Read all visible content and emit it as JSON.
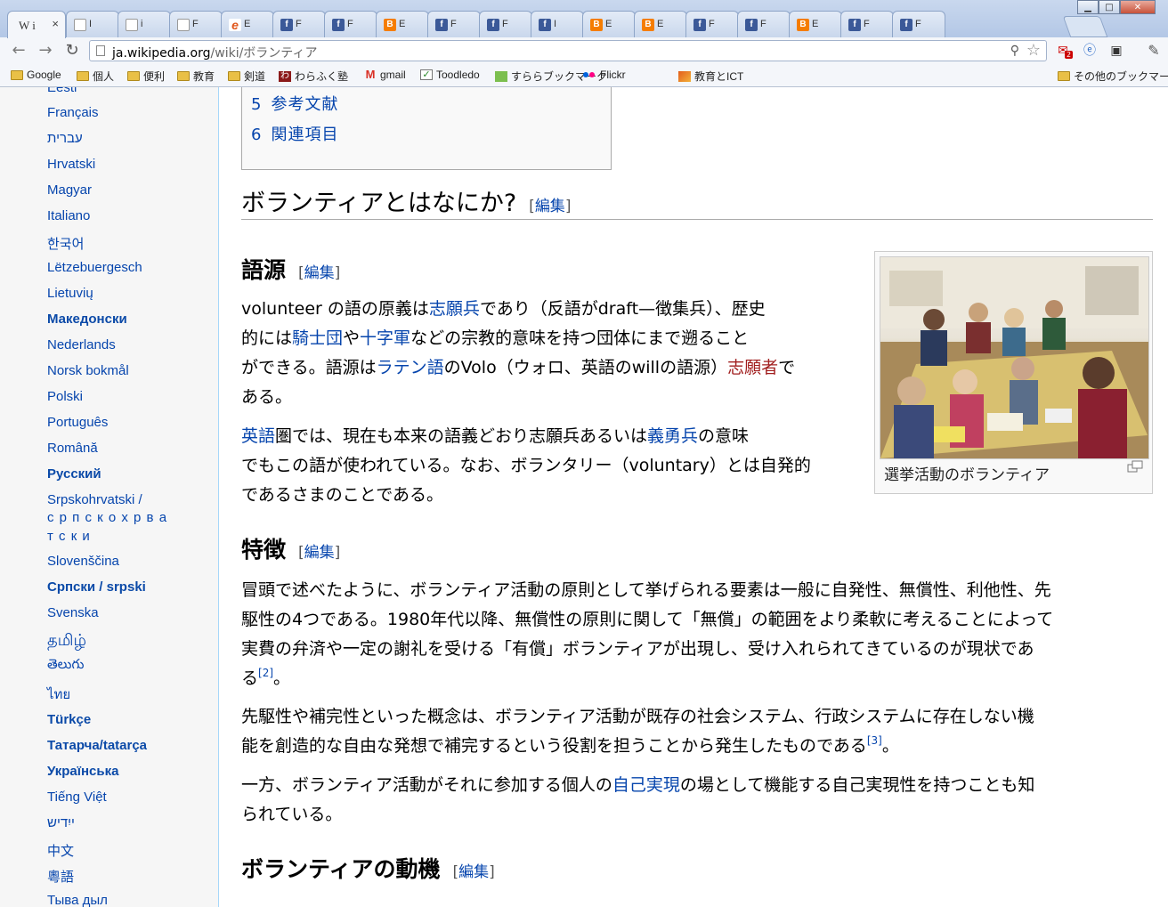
{
  "browser": {
    "tabs": [
      {
        "title": "W i",
        "icon": "wikipedia-w-icon",
        "active": true
      },
      {
        "title": "I",
        "icon": "page-icon"
      },
      {
        "title": "i",
        "icon": "page-icon"
      },
      {
        "title": "F",
        "icon": "page-icon"
      },
      {
        "title": "E",
        "icon": "ie-icon"
      },
      {
        "title": "F",
        "icon": "facebook-icon"
      },
      {
        "title": "F",
        "icon": "facebook-icon"
      },
      {
        "title": "E",
        "icon": "blogger-icon"
      },
      {
        "title": "F",
        "icon": "facebook-icon"
      },
      {
        "title": "F",
        "icon": "facebook-icon"
      },
      {
        "title": "I",
        "icon": "facebook-icon"
      },
      {
        "title": "E",
        "icon": "blogger-icon"
      },
      {
        "title": "E",
        "icon": "blogger-icon"
      },
      {
        "title": "F",
        "icon": "facebook-icon"
      },
      {
        "title": "F",
        "icon": "facebook-icon"
      },
      {
        "title": "E",
        "icon": "blogger-icon"
      },
      {
        "title": "F",
        "icon": "facebook-icon"
      },
      {
        "title": "F",
        "icon": "facebook-icon"
      }
    ],
    "tab_close": "×",
    "window_buttons": {
      "minimize": "▁",
      "maximize": "□",
      "close": "✕"
    },
    "url_host": "ja.wikipedia.org",
    "url_path": "/wiki/ボランティア",
    "zoom_glyph": "⚲",
    "star_glyph": "☆",
    "ext_badge": "2",
    "bookmarks": [
      {
        "label": "Google",
        "icon": "folder"
      },
      {
        "label": "個人",
        "icon": "folder"
      },
      {
        "label": "便利",
        "icon": "folder"
      },
      {
        "label": "教育",
        "icon": "folder"
      },
      {
        "label": "剣道",
        "icon": "folder"
      },
      {
        "label": "わらふく塾",
        "icon": "waraku"
      },
      {
        "label": "gmail",
        "icon": "gmail"
      },
      {
        "label": "Toodledo",
        "icon": "check"
      },
      {
        "label": "すららブックマーク",
        "icon": "srr"
      },
      {
        "label": "Flickr",
        "icon": "flickr"
      },
      {
        "label": "教育とICT",
        "icon": "ict"
      }
    ],
    "other_bookmarks": "その他のブックマーク"
  },
  "sidebar": {
    "languages": [
      "Eesti",
      "Français",
      "עברית",
      "Hrvatski",
      "Magyar",
      "Italiano",
      "한국어",
      "Lëtzebuergesch",
      "Lietuvių",
      "Македонски",
      "Nederlands",
      "Norsk bokmål",
      "Polski",
      "Português",
      "Română",
      "Русский",
      "Srpskohrvatski /",
      "с р п с к о х р в а",
      "т с к и",
      "Slovenščina",
      "Српски / srpski",
      "Svenska",
      "தமிழ்",
      "తెలుగు",
      "ไทย",
      "Türkçe",
      "Татарча/tatarça",
      "Українська",
      "Tiếng Việt",
      "ייִדיש",
      "中文",
      "粵語",
      "Тыва дыл"
    ]
  },
  "toc": [
    {
      "num": "5",
      "label": "参考文献"
    },
    {
      "num": "6",
      "label": "関連項目"
    }
  ],
  "edit_label": "編集",
  "sections": {
    "what": {
      "heading": "ボランティアとはなにか?"
    },
    "etymology": {
      "heading": "語源",
      "p1": {
        "t1": "volunteer の語の原義は",
        "l1": "志願兵",
        "t2": "であり（反語がdraft—徴集兵）、歴史",
        "t3": "的には",
        "l2": "騎士団",
        "t4": "や",
        "l3": "十字軍",
        "t5": "などの宗教的意味を持つ団体にまで遡ること",
        "t6": "ができる。語源は",
        "l4": "ラテン語",
        "t7": "のVolo（ウォロ、英語のwillの語源）",
        "l5": "志願者",
        "t8": "で",
        "t9": "ある。"
      },
      "p2": {
        "l1": "英語",
        "t1": "圏では、現在も本来の語義どおり志願兵あるいは",
        "l2": "義勇兵",
        "t2": "の意味",
        "t3": "でもこの語が使われている。なお、ボランタリー（voluntary）とは自発的",
        "t4": "であるさまのことである。"
      },
      "image_caption": "選挙活動のボランティア"
    },
    "features": {
      "heading": "特徴",
      "p1": {
        "t1": "冒頭で述べたように、ボランティア活動の原則として挙げられる要素は一般に自発性、無償性、利他性、先",
        "t2": "駆性の4つである。1980年代以降、無償性の原則に関して「無償」の範囲をより柔軟に考えることによって",
        "t3": "実費の弁済や一定の謝礼を受ける「有償」ボランティアが出現し、受け入れられてきているのが現状であ",
        "t4": "る",
        "ref": "[2]",
        "t5": "。"
      },
      "p2": {
        "t1": "先駆性や補完性といった概念は、ボランティア活動が既存の社会システム、行政システムに存在しない機",
        "t2": "能を創造的な自由な発想で補完するという役割を担うことから発生したものである",
        "ref": "[3]",
        "t3": "。"
      },
      "p3": {
        "t1": "一方、ボランティア活動がそれに参加する個人の",
        "l1": "自己実現",
        "t2": "の場として機能する自己実現性を持つことも知",
        "t3": "られている。"
      }
    },
    "motivation": {
      "heading": "ボランティアの動機"
    }
  }
}
